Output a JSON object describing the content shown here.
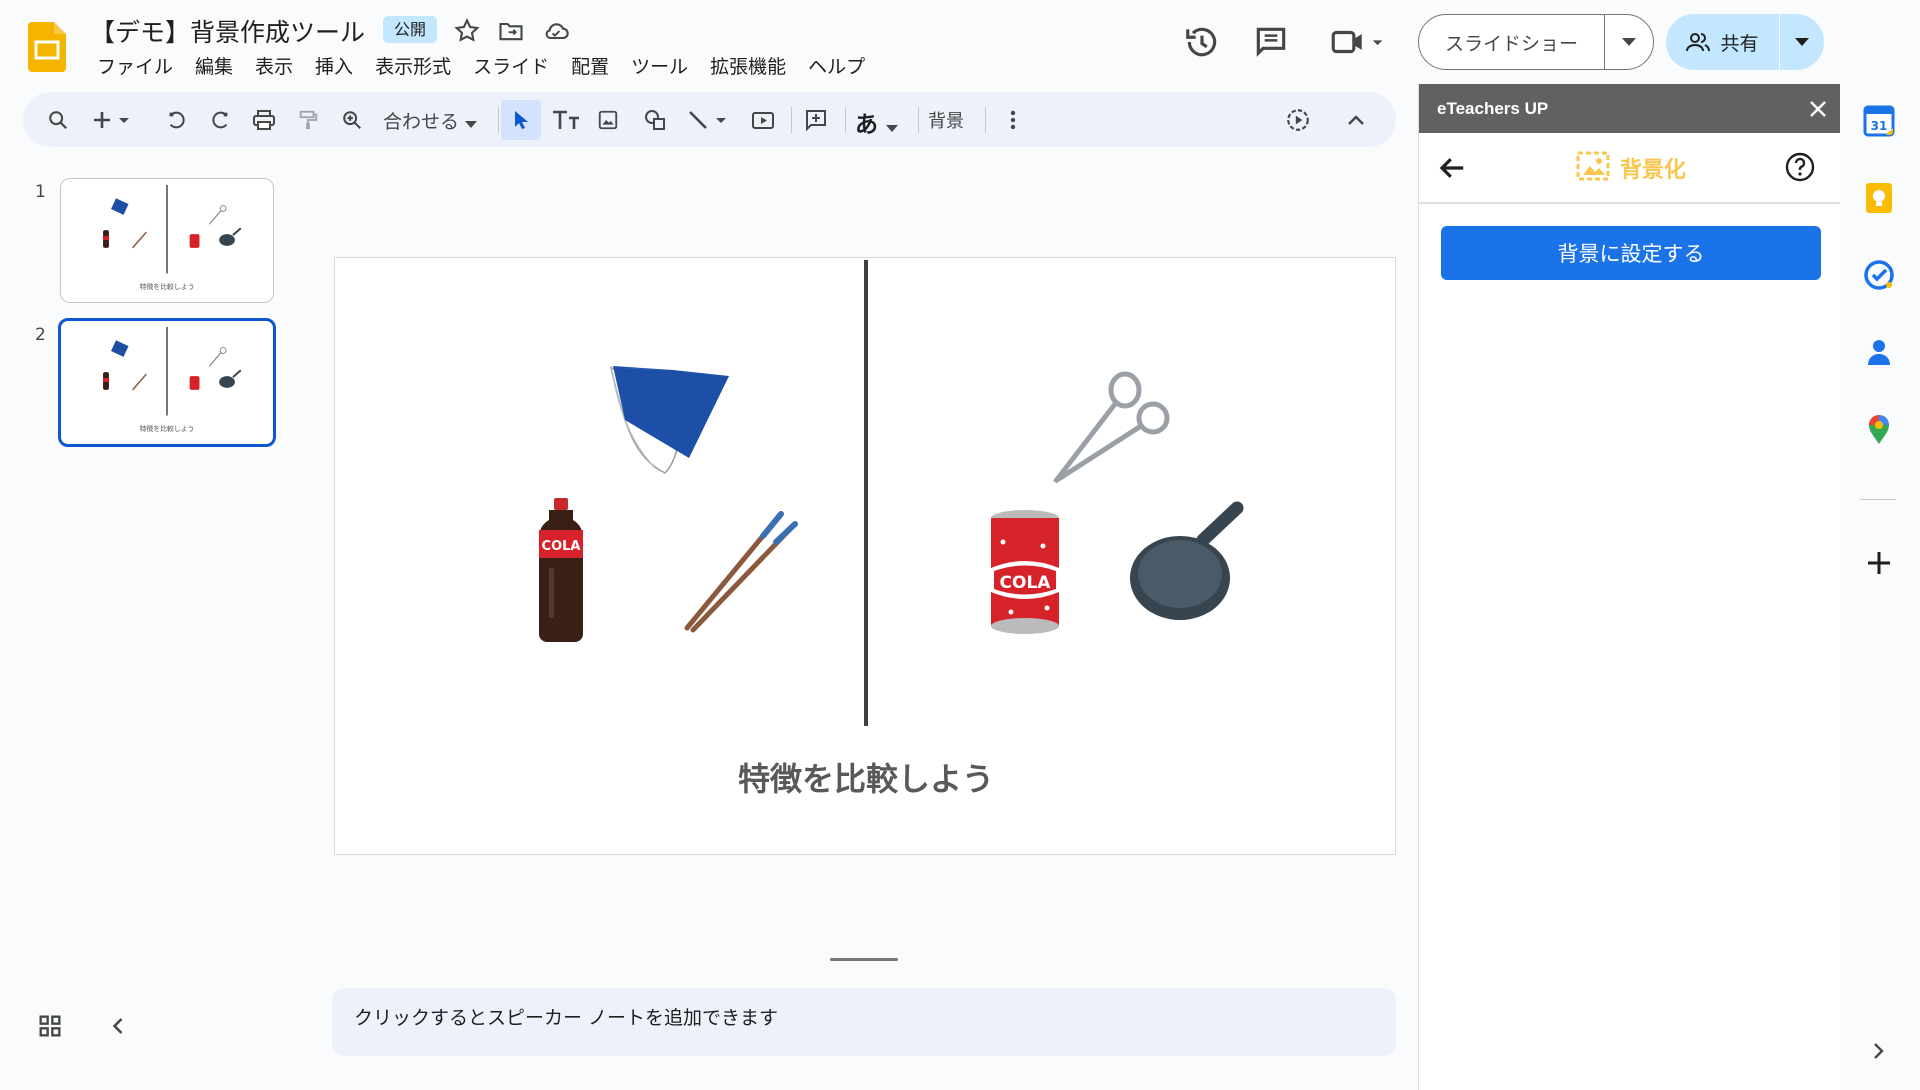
{
  "header": {
    "doc_title": "【デモ】背景作成ツール",
    "badge": "公開",
    "menu": [
      "ファイル",
      "編集",
      "表示",
      "挿入",
      "表示形式",
      "スライド",
      "配置",
      "ツール",
      "拡張機能",
      "ヘルプ"
    ],
    "slideshow_label": "スライドショー",
    "share_label": "共有"
  },
  "toolbar": {
    "zoom_label": "合わせる",
    "text_style_glyph": "あ",
    "background_label": "背景"
  },
  "filmstrip": {
    "slides": [
      {
        "number": "1",
        "caption": "特徴を比較しよう"
      },
      {
        "number": "2",
        "caption": "特徴を比較しよう"
      }
    ],
    "active_slide": 2
  },
  "slide": {
    "caption": "特徴を比較しよう",
    "left_items": [
      "mask-illustration",
      "cola-bottle-illustration",
      "chopsticks-illustration"
    ],
    "right_items": [
      "scissors-illustration",
      "cola-can-illustration",
      "frying-pan-illustration"
    ],
    "label_text": "COLA"
  },
  "notes": {
    "placeholder": "クリックするとスピーカー ノートを追加できます"
  },
  "addon_panel": {
    "title": "eTeachers UP",
    "section_title": "背景化",
    "primary_button": "背景に設定する"
  },
  "rail": {
    "icons": [
      "calendar-icon",
      "keep-icon",
      "tasks-icon",
      "contacts-icon",
      "maps-icon",
      "add-icon"
    ],
    "calendar_day": "31"
  },
  "colors": {
    "accent": "#0b57d0",
    "share_bg": "#c2e7ff",
    "toolbar_bg": "#edf2fa",
    "panel_header": "#616161",
    "panel_button": "#1a73e8",
    "section_title": "#f9c74f"
  }
}
